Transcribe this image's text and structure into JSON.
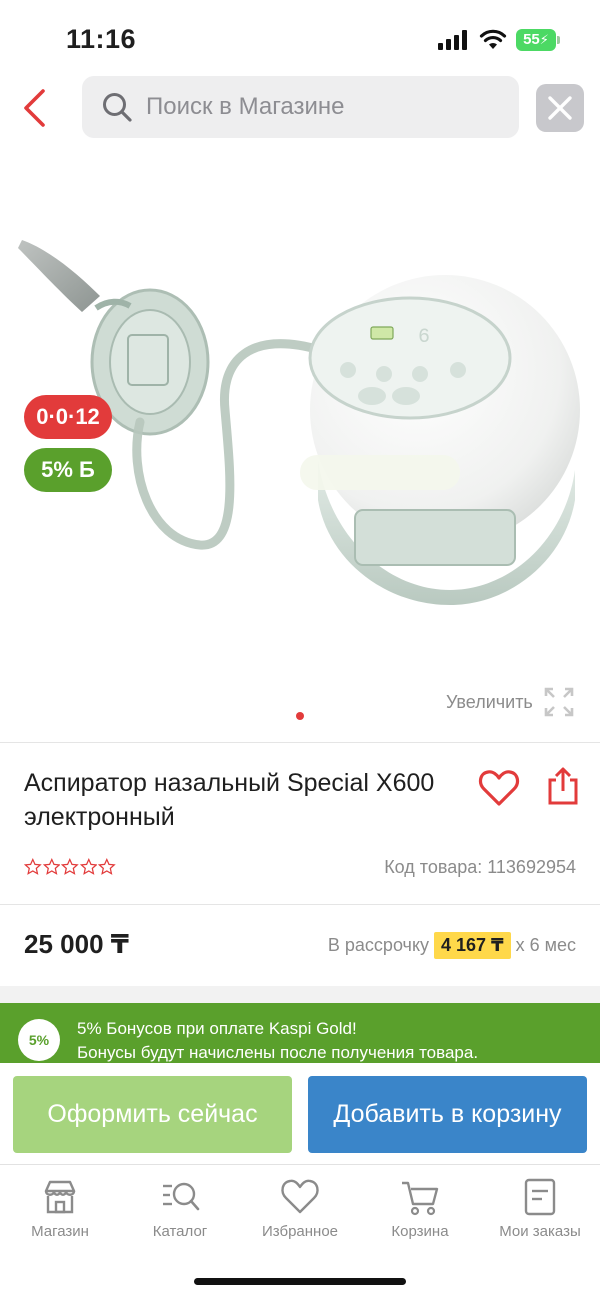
{
  "status_bar": {
    "time": "11:16",
    "battery": "55"
  },
  "header": {
    "search_placeholder": "Поиск в Магазине",
    "icons": [
      "chevron-left-icon",
      "search-icon",
      "close-icon"
    ]
  },
  "gallery": {
    "badge_installment": "0·0·12",
    "badge_bonus": "5% Б",
    "zoom_label": "Увеличить",
    "current_page": 1
  },
  "product": {
    "title": "Аспиратор назальный Special X600 электронный",
    "rating": 0,
    "rating_max": 5,
    "sku": "Код товара: 113692954"
  },
  "price": {
    "value": "25 000 ₸",
    "installment_prefix": "В рассрочку",
    "installment_amount": "4 167 ₸",
    "installment_suffix": "x 6 мес"
  },
  "bonus_banner": {
    "badge": "5%",
    "line1": "5% Бонусов при оплате Kaspi Gold!",
    "line2": "Бонусы будут начислены после получения товара."
  },
  "actions": {
    "buy_now": "Оформить сейчас",
    "add_to_cart": "Добавить в корзину"
  },
  "tabs": [
    {
      "label": "Магазин",
      "icon": "shop-icon"
    },
    {
      "label": "Каталог",
      "icon": "catalog-icon"
    },
    {
      "label": "Избранное",
      "icon": "heart-icon"
    },
    {
      "label": "Корзина",
      "icon": "cart-icon"
    },
    {
      "label": "Мои заказы",
      "icon": "orders-icon"
    }
  ],
  "colors": {
    "accent_red": "#e23b3b",
    "bonus_green": "#5aa02c",
    "buy_now_green": "#a6d47e",
    "cart_blue": "#3a85c9",
    "installment_yellow": "#ffd84a"
  }
}
